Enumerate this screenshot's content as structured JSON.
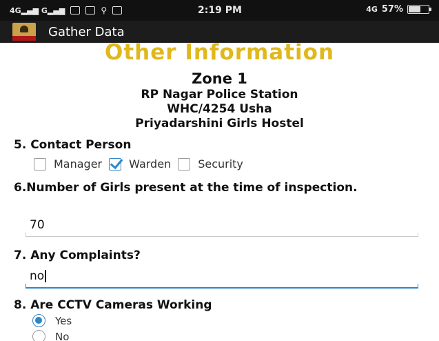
{
  "status_bar": {
    "signal_left": "4Gᴵᴵᴵ Gᴵᴵᴵ",
    "time": "2:19 PM",
    "network": "4G",
    "battery": "57%"
  },
  "app": {
    "title": "Gather Data"
  },
  "page": {
    "heading": "Other Information",
    "zone": "Zone 1",
    "station": "RP Nagar Police Station",
    "officer": "WHC/4254 Usha",
    "hostel": "Priyadarshini Girls Hostel"
  },
  "q5": {
    "label": "5. Contact Person",
    "options": [
      {
        "label": "Manager",
        "checked": false
      },
      {
        "label": "Warden",
        "checked": true
      },
      {
        "label": "Security",
        "checked": false
      }
    ]
  },
  "q6": {
    "label": "6.Number of Girls present at the time of inspection.",
    "value": "70"
  },
  "q7": {
    "label": "7. Any Complaints?",
    "value": "no"
  },
  "q8": {
    "label": "8. Are CCTV Cameras Working",
    "options": [
      {
        "label": "Yes",
        "selected": true
      },
      {
        "label": "No",
        "selected": false
      }
    ]
  },
  "colors": {
    "accent": "#2e86c9",
    "heading": "#e0b81c"
  }
}
